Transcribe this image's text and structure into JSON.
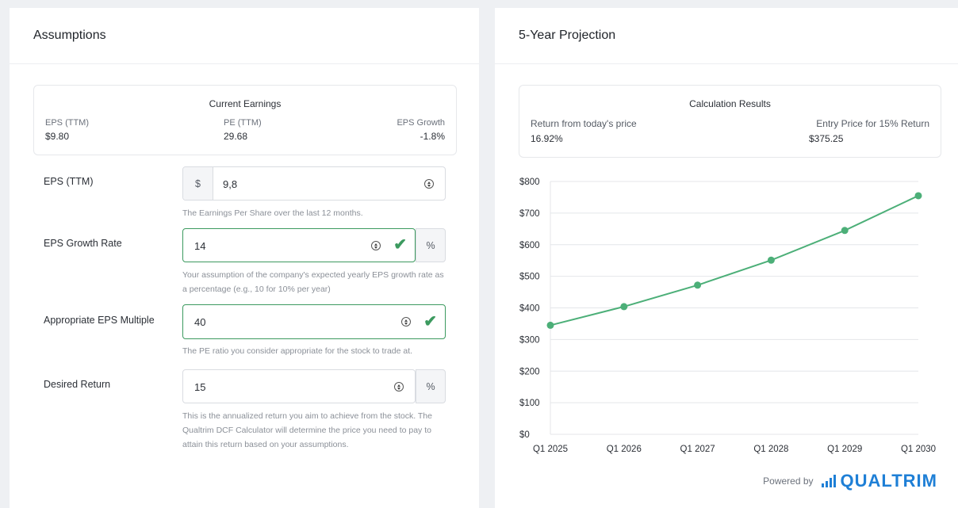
{
  "left": {
    "title": "Assumptions",
    "current_earnings": {
      "title": "Current Earnings",
      "eps_label": "EPS (TTM)",
      "eps_value": "$9.80",
      "pe_label": "PE (TTM)",
      "pe_value": "29.68",
      "growth_label": "EPS Growth",
      "growth_value": "-1.8%"
    },
    "fields": {
      "eps": {
        "label": "EPS (TTM)",
        "prefix": "$",
        "value": "9,8",
        "help": "The Earnings Per Share over the last 12 months."
      },
      "growth": {
        "label": "EPS Growth Rate",
        "value": "14",
        "suffix": "%",
        "help": "Your assumption of the company's expected yearly EPS growth rate as a percentage (e.g., 10 for 10% per year)"
      },
      "multiple": {
        "label": "Appropriate EPS Multiple",
        "value": "40",
        "help": "The PE ratio you consider appropriate for the stock to trade at."
      },
      "return": {
        "label": "Desired Return",
        "value": "15",
        "suffix": "%",
        "help": "This is the annualized return you aim to achieve from the stock. The Qualtrim DCF Calculator will determine the price you need to pay to attain this return based on your assumptions."
      }
    }
  },
  "right": {
    "title": "5-Year Projection",
    "results": {
      "title": "Calculation Results",
      "return_label": "Return from today's price",
      "return_value": "16.92%",
      "entry_label": "Entry Price for 15% Return",
      "entry_value": "$375.25"
    },
    "powered_by": "Powered by",
    "brand": "QUALTRIM",
    "brand_icon": "bar-chart-logo-icon"
  },
  "colors": {
    "accent": "#1e7fd6",
    "line": "#4caf78",
    "valid": "#3c9a5f"
  },
  "chart_data": {
    "type": "line",
    "x": [
      "Q1 2025",
      "Q1 2026",
      "Q1 2027",
      "Q1 2028",
      "Q1 2029",
      "Q1 2030"
    ],
    "series": [
      {
        "values": [
          345,
          404,
          472,
          551,
          645,
          755
        ]
      }
    ],
    "y_ticks": [
      "$0",
      "$100",
      "$200",
      "$300",
      "$400",
      "$500",
      "$600",
      "$700",
      "$800"
    ],
    "ylim": [
      0,
      800
    ],
    "grid": true
  }
}
